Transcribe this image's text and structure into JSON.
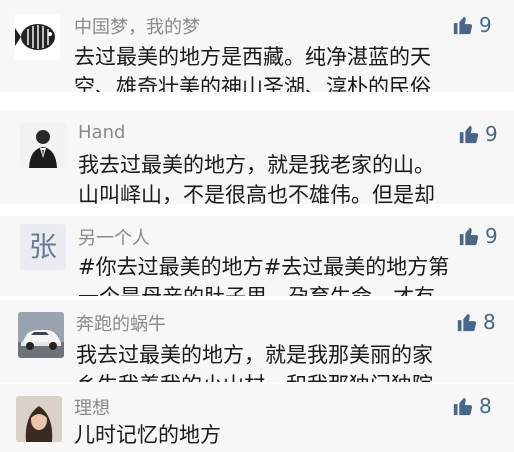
{
  "like_color": "#4a6688",
  "comments": [
    {
      "avatar_icon": "fish-logo-avatar",
      "username": "中国梦，我的梦",
      "likes": "9",
      "line1": "去过最美的地方是西藏。纯净湛蓝的天",
      "line2": "空、雄奇壮美的神山圣湖、淳朴的民俗"
    },
    {
      "avatar_icon": "man-in-suit-avatar",
      "username": "Hand",
      "likes": "9",
      "line1": "我去过最美的地方，就是我老家的山。",
      "line2": "山叫峄山，不是很高也不雄伟。但是却"
    },
    {
      "avatar_icon": "calligraphy-avatar",
      "avatar_char": "张",
      "username": "另一个人",
      "likes": "9",
      "line1": "#你去过最美的地方#去过最美的地方第",
      "line2": "一个是母亲的肚子里，孕育生命。才有"
    },
    {
      "avatar_icon": "white-car-avatar",
      "username": "奔跑的蜗牛",
      "likes": "8",
      "line1": "我去过最美的地方，就是我那美丽的家",
      "line2": "乡生我养我的小山村，和我那独门独院"
    },
    {
      "avatar_icon": "person-photo-avatar",
      "username": "理想",
      "likes": "8",
      "line1": "儿时记忆的地方"
    }
  ]
}
